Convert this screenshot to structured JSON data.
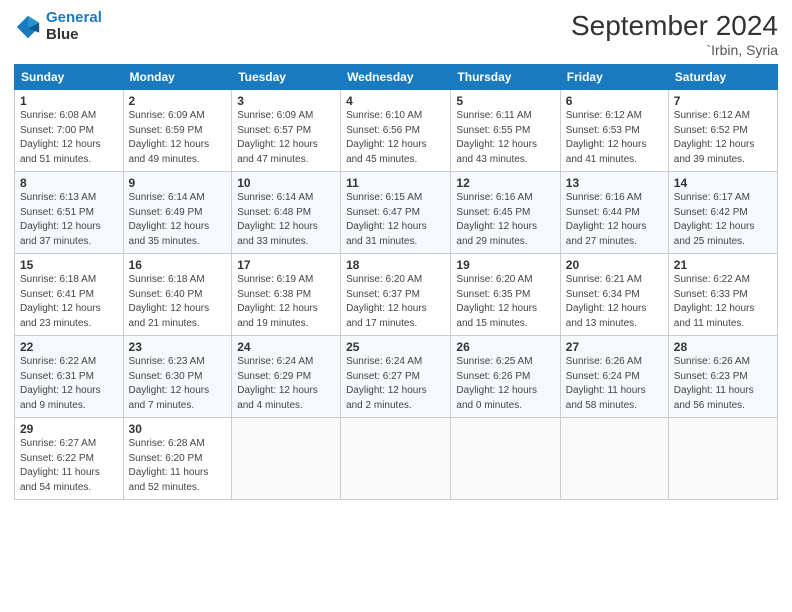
{
  "header": {
    "logo_line1": "General",
    "logo_line2": "Blue",
    "month_title": "September 2024",
    "location": "`Irbin, Syria"
  },
  "days_of_week": [
    "Sunday",
    "Monday",
    "Tuesday",
    "Wednesday",
    "Thursday",
    "Friday",
    "Saturday"
  ],
  "weeks": [
    [
      {
        "day": "1",
        "sunrise": "6:08 AM",
        "sunset": "7:00 PM",
        "daylight": "12 hours and 51 minutes."
      },
      {
        "day": "2",
        "sunrise": "6:09 AM",
        "sunset": "6:59 PM",
        "daylight": "12 hours and 49 minutes."
      },
      {
        "day": "3",
        "sunrise": "6:09 AM",
        "sunset": "6:57 PM",
        "daylight": "12 hours and 47 minutes."
      },
      {
        "day": "4",
        "sunrise": "6:10 AM",
        "sunset": "6:56 PM",
        "daylight": "12 hours and 45 minutes."
      },
      {
        "day": "5",
        "sunrise": "6:11 AM",
        "sunset": "6:55 PM",
        "daylight": "12 hours and 43 minutes."
      },
      {
        "day": "6",
        "sunrise": "6:12 AM",
        "sunset": "6:53 PM",
        "daylight": "12 hours and 41 minutes."
      },
      {
        "day": "7",
        "sunrise": "6:12 AM",
        "sunset": "6:52 PM",
        "daylight": "12 hours and 39 minutes."
      }
    ],
    [
      {
        "day": "8",
        "sunrise": "6:13 AM",
        "sunset": "6:51 PM",
        "daylight": "12 hours and 37 minutes."
      },
      {
        "day": "9",
        "sunrise": "6:14 AM",
        "sunset": "6:49 PM",
        "daylight": "12 hours and 35 minutes."
      },
      {
        "day": "10",
        "sunrise": "6:14 AM",
        "sunset": "6:48 PM",
        "daylight": "12 hours and 33 minutes."
      },
      {
        "day": "11",
        "sunrise": "6:15 AM",
        "sunset": "6:47 PM",
        "daylight": "12 hours and 31 minutes."
      },
      {
        "day": "12",
        "sunrise": "6:16 AM",
        "sunset": "6:45 PM",
        "daylight": "12 hours and 29 minutes."
      },
      {
        "day": "13",
        "sunrise": "6:16 AM",
        "sunset": "6:44 PM",
        "daylight": "12 hours and 27 minutes."
      },
      {
        "day": "14",
        "sunrise": "6:17 AM",
        "sunset": "6:42 PM",
        "daylight": "12 hours and 25 minutes."
      }
    ],
    [
      {
        "day": "15",
        "sunrise": "6:18 AM",
        "sunset": "6:41 PM",
        "daylight": "12 hours and 23 minutes."
      },
      {
        "day": "16",
        "sunrise": "6:18 AM",
        "sunset": "6:40 PM",
        "daylight": "12 hours and 21 minutes."
      },
      {
        "day": "17",
        "sunrise": "6:19 AM",
        "sunset": "6:38 PM",
        "daylight": "12 hours and 19 minutes."
      },
      {
        "day": "18",
        "sunrise": "6:20 AM",
        "sunset": "6:37 PM",
        "daylight": "12 hours and 17 minutes."
      },
      {
        "day": "19",
        "sunrise": "6:20 AM",
        "sunset": "6:35 PM",
        "daylight": "12 hours and 15 minutes."
      },
      {
        "day": "20",
        "sunrise": "6:21 AM",
        "sunset": "6:34 PM",
        "daylight": "12 hours and 13 minutes."
      },
      {
        "day": "21",
        "sunrise": "6:22 AM",
        "sunset": "6:33 PM",
        "daylight": "12 hours and 11 minutes."
      }
    ],
    [
      {
        "day": "22",
        "sunrise": "6:22 AM",
        "sunset": "6:31 PM",
        "daylight": "12 hours and 9 minutes."
      },
      {
        "day": "23",
        "sunrise": "6:23 AM",
        "sunset": "6:30 PM",
        "daylight": "12 hours and 7 minutes."
      },
      {
        "day": "24",
        "sunrise": "6:24 AM",
        "sunset": "6:29 PM",
        "daylight": "12 hours and 4 minutes."
      },
      {
        "day": "25",
        "sunrise": "6:24 AM",
        "sunset": "6:27 PM",
        "daylight": "12 hours and 2 minutes."
      },
      {
        "day": "26",
        "sunrise": "6:25 AM",
        "sunset": "6:26 PM",
        "daylight": "12 hours and 0 minutes."
      },
      {
        "day": "27",
        "sunrise": "6:26 AM",
        "sunset": "6:24 PM",
        "daylight": "11 hours and 58 minutes."
      },
      {
        "day": "28",
        "sunrise": "6:26 AM",
        "sunset": "6:23 PM",
        "daylight": "11 hours and 56 minutes."
      }
    ],
    [
      {
        "day": "29",
        "sunrise": "6:27 AM",
        "sunset": "6:22 PM",
        "daylight": "11 hours and 54 minutes."
      },
      {
        "day": "30",
        "sunrise": "6:28 AM",
        "sunset": "6:20 PM",
        "daylight": "11 hours and 52 minutes."
      },
      null,
      null,
      null,
      null,
      null
    ]
  ]
}
